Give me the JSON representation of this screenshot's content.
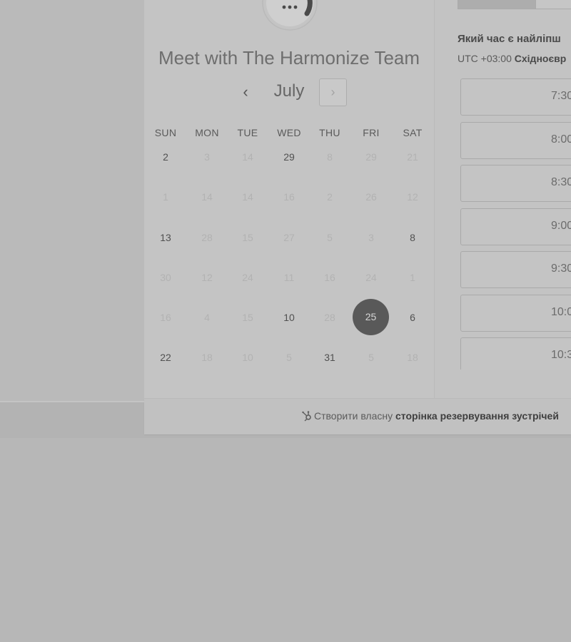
{
  "meeting": {
    "title": "Meet with The Harmonize Team"
  },
  "calendar": {
    "month": "July",
    "prev_icon": "‹",
    "next_icon": "›",
    "weekdays": [
      "SUN",
      "MON",
      "TUE",
      "WED",
      "THU",
      "FRI",
      "SAT"
    ],
    "weeks": [
      [
        {
          "d": "2",
          "on": true
        },
        {
          "d": "3",
          "on": false
        },
        {
          "d": "14",
          "on": false
        },
        {
          "d": "29",
          "on": true
        },
        {
          "d": "8",
          "on": false
        },
        {
          "d": "29",
          "on": false
        },
        {
          "d": "21",
          "on": false
        }
      ],
      [
        {
          "d": "1",
          "on": false
        },
        {
          "d": "14",
          "on": false
        },
        {
          "d": "14",
          "on": false
        },
        {
          "d": "16",
          "on": false
        },
        {
          "d": "2",
          "on": false
        },
        {
          "d": "26",
          "on": false
        },
        {
          "d": "12",
          "on": false
        }
      ],
      [
        {
          "d": "13",
          "on": true
        },
        {
          "d": "28",
          "on": false
        },
        {
          "d": "15",
          "on": false
        },
        {
          "d": "27",
          "on": false
        },
        {
          "d": "5",
          "on": false
        },
        {
          "d": "3",
          "on": false
        },
        {
          "d": "8",
          "on": true
        }
      ],
      [
        {
          "d": "30",
          "on": false
        },
        {
          "d": "12",
          "on": false
        },
        {
          "d": "24",
          "on": false
        },
        {
          "d": "11",
          "on": false
        },
        {
          "d": "16",
          "on": false
        },
        {
          "d": "24",
          "on": false
        },
        {
          "d": "1",
          "on": false
        }
      ],
      [
        {
          "d": "16",
          "on": false
        },
        {
          "d": "4",
          "on": false
        },
        {
          "d": "15",
          "on": false
        },
        {
          "d": "10",
          "on": true
        },
        {
          "d": "28",
          "on": false
        },
        {
          "d": "25",
          "on": true,
          "selected": true
        },
        {
          "d": "6",
          "on": true
        }
      ],
      [
        {
          "d": "22",
          "on": true
        },
        {
          "d": "18",
          "on": false
        },
        {
          "d": "10",
          "on": false
        },
        {
          "d": "5",
          "on": false
        },
        {
          "d": "31",
          "on": true
        },
        {
          "d": "5",
          "on": false
        },
        {
          "d": "18",
          "on": false
        }
      ]
    ]
  },
  "times": {
    "title": "Який час є найліпш",
    "timezone_offset": "UTC +03:00",
    "timezone_name": "Східноєвр",
    "slots": [
      "7:30",
      "8:00",
      "8:30",
      "9:00",
      "9:30",
      "10:0",
      "10:3"
    ]
  },
  "footer": {
    "prefix": "Створити власну",
    "bold": "сторінка резервування зустрічей"
  },
  "colors": {
    "selected_day": "#595959",
    "page_background": "#b7b7b7"
  }
}
